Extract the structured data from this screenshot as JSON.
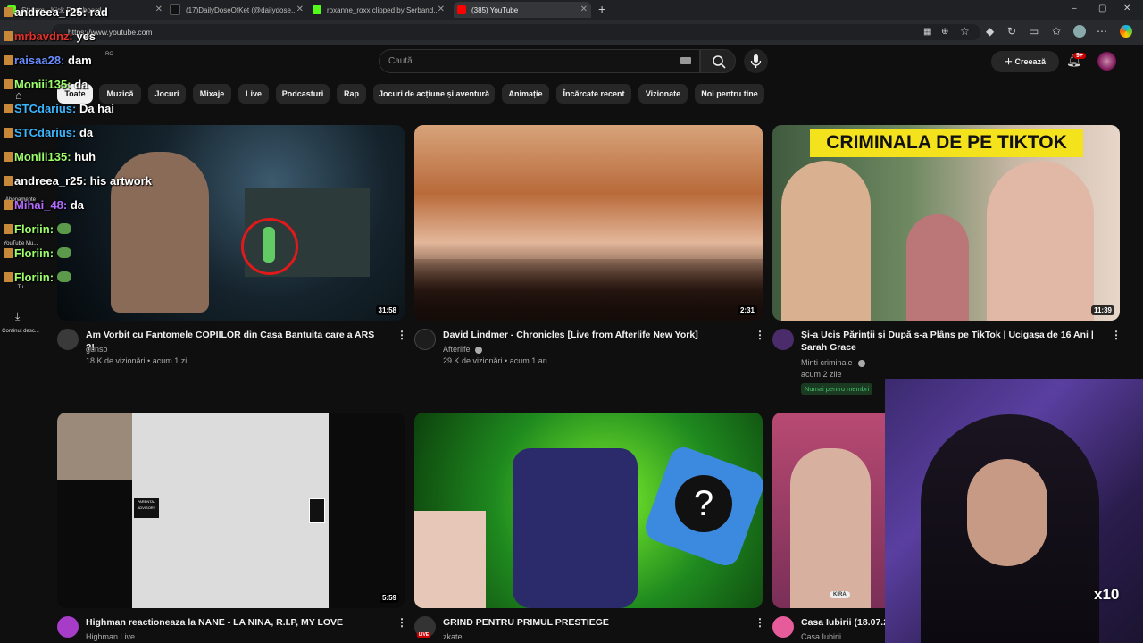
{
  "browser": {
    "tabs": [
      {
        "title": "Stream - Kick Dashboard"
      },
      {
        "title": "(17)DailyDoseOfKet (@dailydose..."
      },
      {
        "title": "roxanne_roxx clipped by Serband..."
      },
      {
        "title": "(385) YouTube"
      }
    ],
    "url": "https://www.youtube.com"
  },
  "youtube": {
    "country": "RO",
    "search_placeholder": "Caută",
    "create_label": "Creează",
    "notif_count": "9+",
    "chips": [
      "Toate",
      "Muzică",
      "Jocuri",
      "Mixaje",
      "Live",
      "Podcasturi",
      "Rap",
      "Jocuri de acțiune și aventură",
      "Animație",
      "Încărcate recent",
      "Vizionate",
      "Noi pentru tine"
    ],
    "sidebar": [
      "Abonamente",
      "YouTube Mu...",
      "Tu",
      "Conținut desc..."
    ],
    "videos": [
      {
        "title": "Am Vorbit cu Fantomele COPIILOR din Casa Bantuita care a ARS ?!",
        "channel": "gunso",
        "stats": "18 K de vizionări • acum 1 zi",
        "duration": "31:58"
      },
      {
        "title": "David Lindmer - Chronicles [Live from Afterlife New York]",
        "channel": "Afterlife",
        "stats": "29 K de vizionări • acum 1 an",
        "duration": "2:31"
      },
      {
        "title": "Și-a Ucis Părinții și După s-a Plâns pe TikTok | Ucigașa de 16 Ani | Sarah Grace",
        "channel": "Minti criminale",
        "stats": "acum 2 zile",
        "duration": "11:39",
        "badge": "Numai pentru membri",
        "thumb_text": "CRIMINALA DE PE TIKTOK"
      },
      {
        "title": "Highman reactioneaza la NANE - LA NINA, R.I.P, MY LOVE",
        "channel": "Highman Live",
        "duration": "5:59",
        "thumb_text": "PARENTAL ADVISORY"
      },
      {
        "title": "GRIND PENTRU PRIMUL PRESTIEGE",
        "channel": "zkate",
        "live_label": "LIVE"
      },
      {
        "title": "Casa Iubirii (18.07.2",
        "channel": "Casa Iubirii",
        "thumb_text": "KIRA"
      }
    ]
  },
  "chat": [
    {
      "user": "andreea_r25:",
      "msg": "rad",
      "color": "#ffffff"
    },
    {
      "user": "mrbavdnz:",
      "msg": "yes",
      "color": "#e0312b"
    },
    {
      "user": "raisaa28:",
      "msg": "dam",
      "color": "#6b8cff"
    },
    {
      "user": "Moniii135:",
      "msg": "da",
      "color": "#9cff6b"
    },
    {
      "user": "STCdarius:",
      "msg": "Da hai",
      "color": "#3cb6ff"
    },
    {
      "user": "STCdarius:",
      "msg": "da",
      "color": "#3cb6ff"
    },
    {
      "user": "Moniii135:",
      "msg": "huh",
      "color": "#9cff6b"
    },
    {
      "user": "andreea_r25:",
      "msg": "his artwork",
      "color": "#ffffff"
    },
    {
      "user": "Mihai_48:",
      "msg": "da",
      "color": "#b56bff"
    },
    {
      "user": "Floriin:",
      "msg": "",
      "color": "#9cff6b"
    },
    {
      "user": "Floriin:",
      "msg": "",
      "color": "#9cff6b"
    },
    {
      "user": "Floriin:",
      "msg": "",
      "color": "#9cff6b"
    }
  ],
  "overlay": {
    "multiplier": "x10"
  }
}
